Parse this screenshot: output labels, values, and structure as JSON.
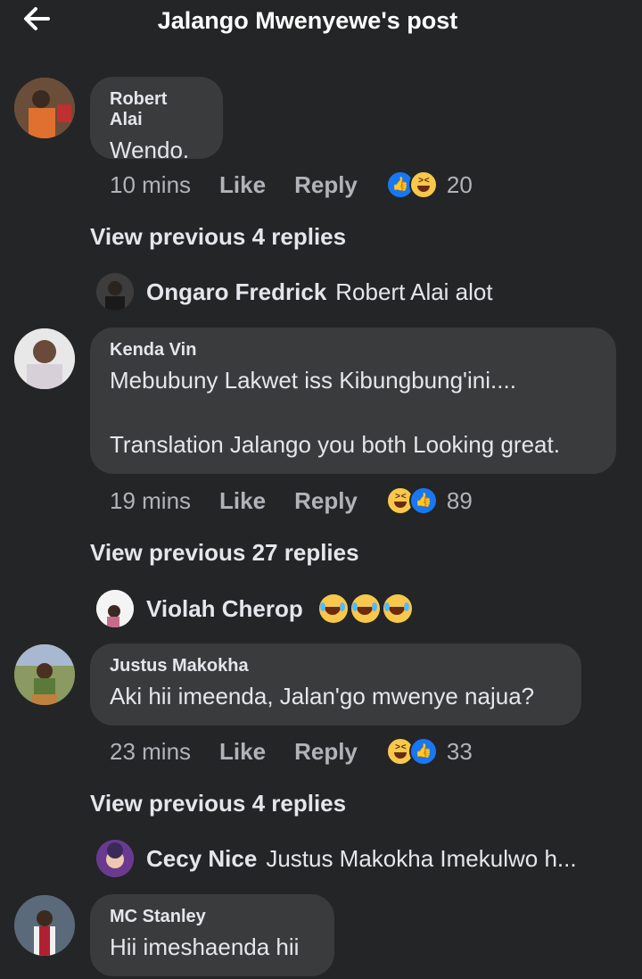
{
  "header": {
    "title": "Jalango Mwenyewe's post"
  },
  "comments": [
    {
      "name": "Robert Alai",
      "text": "Wendo.",
      "time": "10 mins",
      "like": "Like",
      "reply": "Reply",
      "reactions": [
        "like-icon",
        "haha-icon"
      ],
      "count": "20",
      "view_previous": "View previous 4 replies",
      "last_reply": {
        "name": "Ongaro Fredrick",
        "text": "Robert Alai alot"
      }
    },
    {
      "name": "Kenda Vin",
      "text": "Mebubuny Lakwet iss Kibungbung'ini....\n\nTranslation Jalango you both Looking great.",
      "time": "19 mins",
      "like": "Like",
      "reply": "Reply",
      "reactions": [
        "haha-icon",
        "like-icon"
      ],
      "count": "89",
      "view_previous": "View previous 27 replies",
      "last_reply": {
        "name": "Violah Cherop",
        "text": ""
      }
    },
    {
      "name": "Justus Makokha",
      "text": "Aki hii imeenda, Jalan'go mwenye najua?",
      "time": "23 mins",
      "like": "Like",
      "reply": "Reply",
      "reactions": [
        "haha-icon",
        "like-icon"
      ],
      "count": "33",
      "view_previous": "View previous 4 replies",
      "last_reply": {
        "name": "Cecy Nice",
        "text": "Justus Makokha Imekulwo h..."
      }
    },
    {
      "name": "MC Stanley",
      "text": "Hii imeshaenda hii"
    }
  ],
  "colors": {
    "background": "#242526",
    "bubble": "#3a3b3c",
    "like_blue": "#1877f2",
    "emoji_yellow": "#f7c84b"
  }
}
